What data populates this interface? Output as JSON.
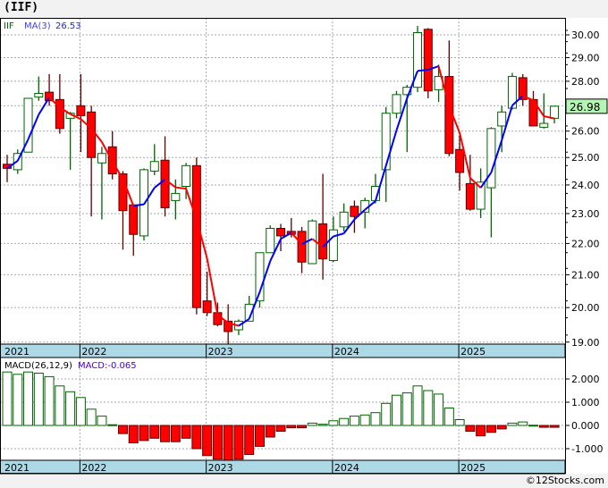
{
  "title": "(IIF)",
  "footer": "©12Stocks.com",
  "legend": {
    "symbol": "IIF",
    "ma_label": "MA(3)",
    "ma_value": "26.53"
  },
  "macd_legend": {
    "label": "MACD(26,12,9)",
    "value_label": "MACD:-0.065"
  },
  "last_price": "26.98",
  "colors": {
    "up": "#006400",
    "down": "#ff0000",
    "ma_up": "#0000ff",
    "ma_down": "#ff0000",
    "date_band": "#add8e6",
    "price_tag": "#b4f5b4"
  },
  "chart_data": [
    {
      "type": "candlestick",
      "title": "",
      "scale": "log",
      "ylim": [
        18.8,
        30.5
      ],
      "y_ticks": [
        "30.00",
        "29.00",
        "28.00",
        "27.00",
        "26.00",
        "25.00",
        "24.00",
        "23.00",
        "22.00",
        "21.00",
        "20.00",
        "19.00"
      ],
      "x_ticks": [
        "2021",
        "2022",
        "2023",
        "2024",
        "2025"
      ],
      "grid": true,
      "legend_position": "top-left",
      "period": "monthly",
      "start": "2021-06",
      "ohlc": [
        [
          24.75,
          25.1,
          24.1,
          24.6
        ],
        [
          24.55,
          25.3,
          24.4,
          25.15
        ],
        [
          25.2,
          27.3,
          25.2,
          27.3
        ],
        [
          27.35,
          28.2,
          27.2,
          27.5
        ],
        [
          27.55,
          28.3,
          27.0,
          27.2
        ],
        [
          27.25,
          28.3,
          25.9,
          26.1
        ],
        [
          26.5,
          26.75,
          24.55,
          26.7
        ],
        [
          27.0,
          28.3,
          25.2,
          26.6
        ],
        [
          26.75,
          27.0,
          22.9,
          25.0
        ],
        [
          24.8,
          25.4,
          22.8,
          25.15
        ],
        [
          25.4,
          26.0,
          24.2,
          24.4
        ],
        [
          24.4,
          24.5,
          21.8,
          23.1
        ],
        [
          23.3,
          23.3,
          21.6,
          22.3
        ],
        [
          22.25,
          24.6,
          22.1,
          24.55
        ],
        [
          24.5,
          25.5,
          24.35,
          24.85
        ],
        [
          24.9,
          25.8,
          22.9,
          23.2
        ],
        [
          23.45,
          24.2,
          22.8,
          23.7
        ],
        [
          23.95,
          24.8,
          23.5,
          24.7
        ],
        [
          24.7,
          25.0,
          19.8,
          20.0
        ],
        [
          20.2,
          21.1,
          19.75,
          19.85
        ],
        [
          19.85,
          20.15,
          19.45,
          19.5
        ],
        [
          19.6,
          20.1,
          18.85,
          19.3
        ],
        [
          19.35,
          19.65,
          19.2,
          19.6
        ],
        [
          19.6,
          20.35,
          19.6,
          20.1
        ],
        [
          20.2,
          21.7,
          20.0,
          21.7
        ],
        [
          21.7,
          22.6,
          21.7,
          22.5
        ],
        [
          22.5,
          22.65,
          21.75,
          22.25
        ],
        [
          22.4,
          22.85,
          22.2,
          22.3
        ],
        [
          22.4,
          22.55,
          21.05,
          21.4
        ],
        [
          21.35,
          22.8,
          21.35,
          22.75
        ],
        [
          22.65,
          24.4,
          20.85,
          21.5
        ],
        [
          21.45,
          22.9,
          21.4,
          22.45
        ],
        [
          22.55,
          23.35,
          22.4,
          23.05
        ],
        [
          23.25,
          23.45,
          22.35,
          22.9
        ],
        [
          23.05,
          23.55,
          22.5,
          23.45
        ],
        [
          23.45,
          24.4,
          23.35,
          23.95
        ],
        [
          24.55,
          26.95,
          23.4,
          26.7
        ],
        [
          26.7,
          27.6,
          26.5,
          27.45
        ],
        [
          27.45,
          27.85,
          25.2,
          27.75
        ],
        [
          27.75,
          30.4,
          27.55,
          30.1
        ],
        [
          30.25,
          30.3,
          27.3,
          27.6
        ],
        [
          27.65,
          28.7,
          27.15,
          28.2
        ],
        [
          28.2,
          29.75,
          25.05,
          25.15
        ],
        [
          25.3,
          25.85,
          23.8,
          24.45
        ],
        [
          24.05,
          25.1,
          23.1,
          23.15
        ],
        [
          23.15,
          24.6,
          22.85,
          24.1
        ],
        [
          23.9,
          26.15,
          22.2,
          26.1
        ],
        [
          26.2,
          27.0,
          25.2,
          26.75
        ],
        [
          26.9,
          28.35,
          26.85,
          28.2
        ],
        [
          28.15,
          28.3,
          27.0,
          27.25
        ],
        [
          27.25,
          27.6,
          26.2,
          26.2
        ],
        [
          26.15,
          27.5,
          26.1,
          26.3
        ],
        [
          26.5,
          27.0,
          26.3,
          26.98
        ]
      ],
      "ma_period": 3
    },
    {
      "type": "bar",
      "title": "MACD(26,12,9)",
      "ylim": [
        -1.6,
        2.5
      ],
      "y_ticks": [
        "2.000",
        "1.000",
        "0.000",
        "-1.000"
      ],
      "x_ticks": [
        "2021",
        "2022",
        "2023",
        "2024",
        "2025"
      ],
      "values": [
        2.3,
        2.2,
        2.3,
        2.25,
        2.1,
        1.7,
        1.45,
        1.2,
        0.7,
        0.4,
        0.03,
        -0.35,
        -0.75,
        -0.65,
        -0.55,
        -0.7,
        -0.7,
        -0.55,
        -1.0,
        -1.3,
        -1.45,
        -1.5,
        -1.45,
        -1.25,
        -0.9,
        -0.5,
        -0.25,
        -0.1,
        -0.1,
        0.1,
        0.05,
        0.2,
        0.3,
        0.4,
        0.45,
        0.55,
        0.95,
        1.3,
        1.4,
        1.7,
        1.5,
        1.35,
        0.75,
        0.25,
        -0.25,
        -0.45,
        -0.3,
        -0.15,
        0.1,
        0.15,
        0.01,
        -0.08,
        -0.08
      ]
    }
  ]
}
